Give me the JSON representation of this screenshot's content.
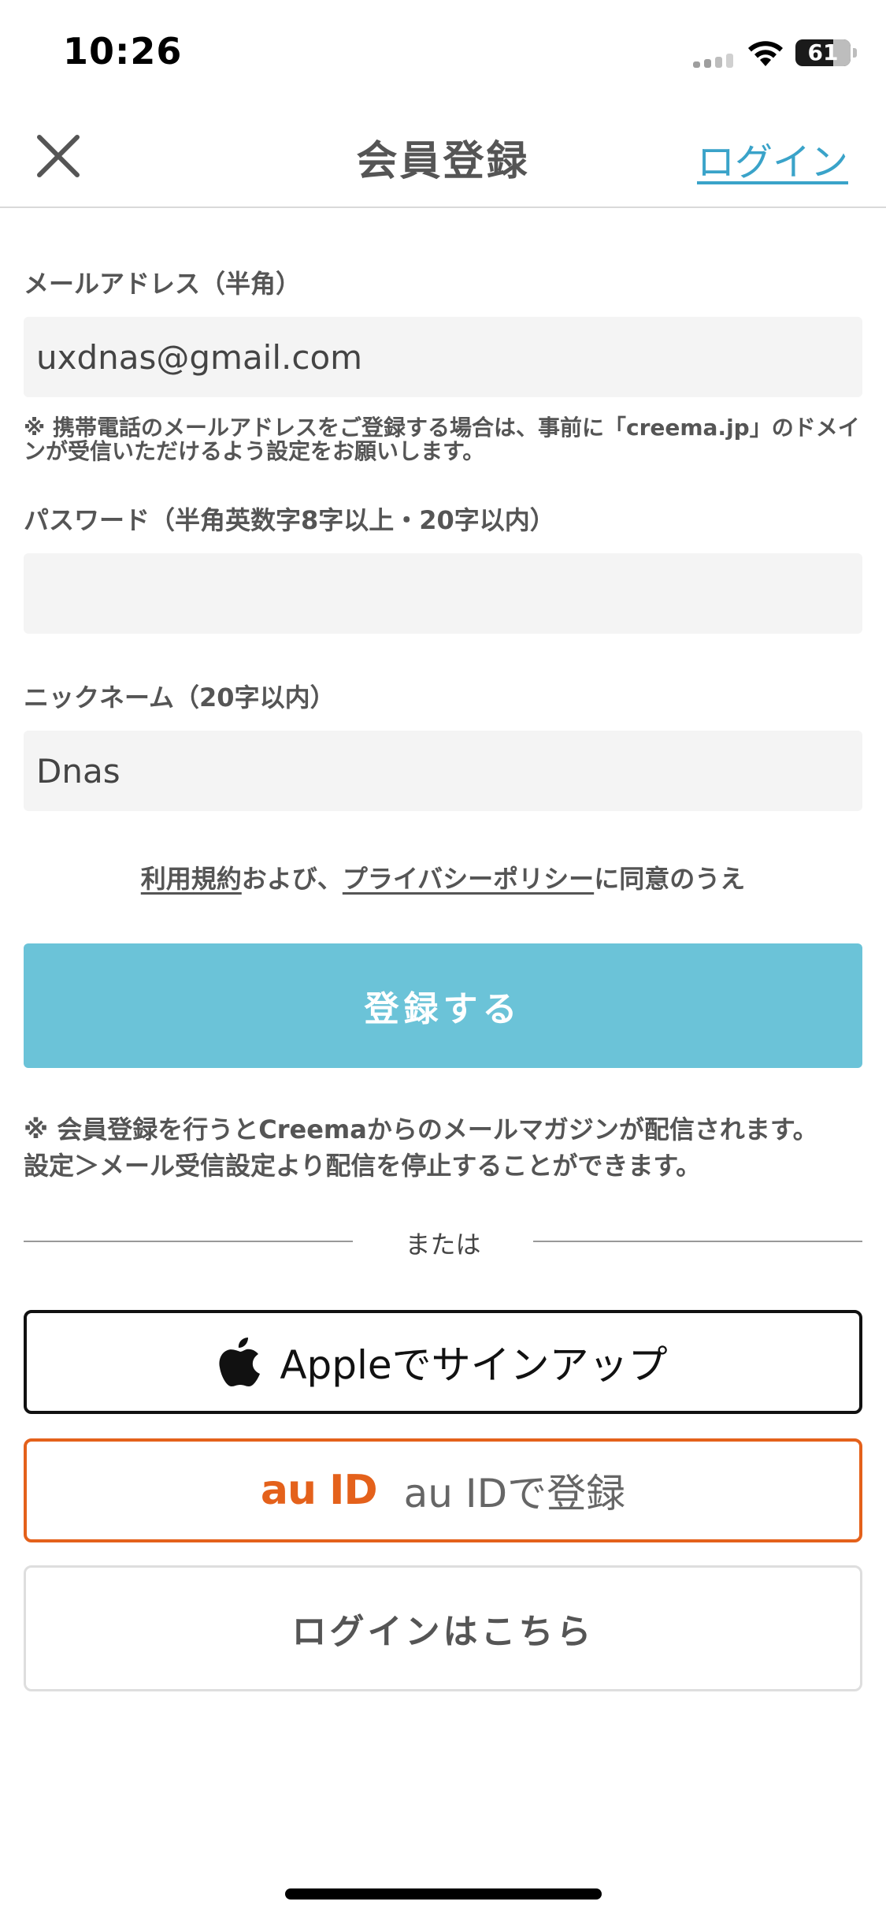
{
  "status_bar": {
    "time": "10:26",
    "battery_level": "61"
  },
  "nav": {
    "title": "会員登録",
    "login_link": "ログイン"
  },
  "form": {
    "email": {
      "label": "メールアドレス（半角）",
      "value": "uxdnas@gmail.com"
    },
    "email_note": "※ 携帯電話のメールアドレスをご登録する場合は、事前に「creema.jp」のドメインが受信いただけるよう設定をお願いします。",
    "password": {
      "label": "パスワード（半角英数字8字以上・20字以内）",
      "value": ""
    },
    "nickname": {
      "label": "ニックネーム（20字以内）",
      "value": "Dnas"
    }
  },
  "agreement": {
    "terms_link": "利用規約",
    "connector": "および、",
    "privacy_link": "プライバシーポリシー",
    "suffix": "に同意のうえ"
  },
  "submit_label": "登録する",
  "mail_note": {
    "line1": "※ 会員登録を行うとCreemaからのメールマガジンが配信されます。",
    "line2": "設定＞メール受信設定より配信を停止することができます。"
  },
  "divider_text": "または",
  "apple_button": {
    "label": "Appleでサインアップ",
    "icon": "apple-icon"
  },
  "au_button": {
    "logo": "au ID",
    "label": "au IDで登録"
  },
  "login_button": "ログインはこちら",
  "colors": {
    "accent": "#6bc3d8",
    "link": "#3aa3c9",
    "au_orange": "#e4611b",
    "field_bg": "#f4f4f4"
  }
}
